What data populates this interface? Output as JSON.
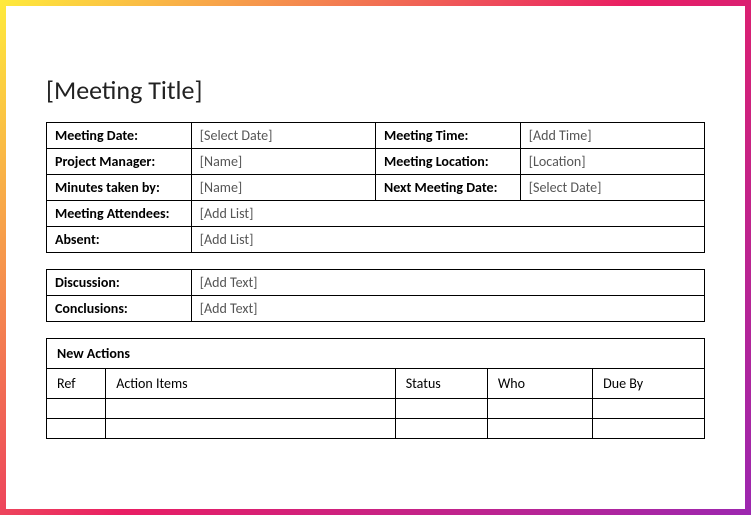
{
  "title": "[Meeting Title]",
  "details": {
    "meeting_date_label": "Meeting Date:",
    "meeting_date_value": "[Select Date]",
    "meeting_time_label": "Meeting Time:",
    "meeting_time_value": "[Add Time]",
    "project_manager_label": "Project Manager:",
    "project_manager_value": "[Name]",
    "meeting_location_label": "Meeting Location:",
    "meeting_location_value": "[Location]",
    "minutes_taken_by_label": "Minutes taken by:",
    "minutes_taken_by_value": "[Name]",
    "next_meeting_date_label": "Next Meeting Date:",
    "next_meeting_date_value": "[Select Date]",
    "attendees_label": "Meeting Attendees:",
    "attendees_value": "[Add List]",
    "absent_label": "Absent:",
    "absent_value": "[Add List]"
  },
  "notes": {
    "discussion_label": "Discussion:",
    "discussion_value": "[Add Text]",
    "conclusions_label": "Conclusions:",
    "conclusions_value": "[Add Text]"
  },
  "actions": {
    "heading": "New Actions",
    "col_ref": "Ref",
    "col_items": "Action Items",
    "col_status": "Status",
    "col_who": "Who",
    "col_due": "Due By"
  }
}
